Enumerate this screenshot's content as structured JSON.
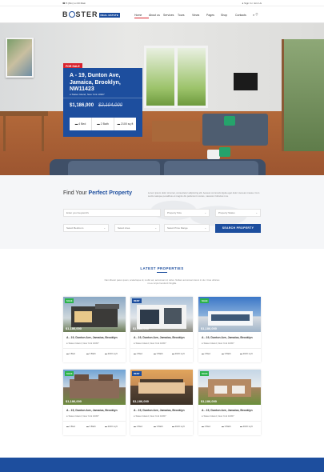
{
  "topbar": {
    "phone": "☎ 8 (8xx) xx 00 Main",
    "login": "● Sign In / Join Us"
  },
  "header": {
    "logo": {
      "b": "B",
      "rest": "STER",
      "tag": "REAL ESTATE"
    },
    "nav": [
      "Home",
      "About us",
      "Services",
      "Tours",
      "Views",
      "Pages",
      "Shop",
      "Contacts"
    ],
    "icons": "⌕  ♡"
  },
  "hero": {
    "tag": "FOR SALE",
    "address": "A - 19, Dunton Ave, Jamaica, Brooklyn, NW11423",
    "location": "● Staten Island, New York 10307",
    "price": "$1,186,000",
    "old_price": "$2,104,000",
    "features": [
      "▬ 4 Bed",
      "▬ 2 Bath",
      "▬ 2100 sq ft"
    ]
  },
  "search": {
    "title_plain": "Find Your ",
    "title_strong": "Perfect Property",
    "description": "Lorem ipsum dolor sit amet, consectetur adipiscing elit. Aenean commodo ligula eget dolor. Aenean massa. Cum sociis natoque penatibus et magnis dis parturient montes, nascetur ridiculus mus.",
    "fields": [
      "Enter your keyword's",
      "Property Size",
      "Property Status",
      "Select Bedroom",
      "Select Area",
      "Select Price Range"
    ],
    "button": "SEARCH PROPERTY"
  },
  "latest": {
    "title": "LATEST PROPERTIES",
    "description": "Nam liberar pacer quam, scelerisque id, mollis vel, accumsan id, tellus. Nullam accumsan lorem in dui. Cras ultricies mi eu turpis hendrerit fringilla."
  },
  "properties": [
    {
      "badge": "SALE",
      "badge_color": "#2bb34b",
      "price": "$1,186,000",
      "title": "A - 19, Dunton Ave, Jamaica, Brooklyn",
      "location": "● Staten Island, New York 10307",
      "feats": [
        "▬ 4 Bed",
        "▬ 3 Bath",
        "▬ 2100 sq ft"
      ]
    },
    {
      "badge": "RENT",
      "badge_color": "#1d4e9e",
      "price": "$1,186,000",
      "title": "A - 19, Dunton Ave, Jamaica, Brooklyn",
      "location": "● Staten Island, New York 10307",
      "feats": [
        "▬ 4 Bed",
        "▬ 3 Bath",
        "▬ 2100 sq ft"
      ]
    },
    {
      "badge": "SALE",
      "badge_color": "#2bb34b",
      "price": "$1,186,000",
      "title": "A - 19, Dunton Ave, Jamaica, Brooklyn",
      "location": "● Staten Island, New York 10307",
      "feats": [
        "▬ 4 Bed",
        "▬ 3 Bath",
        "▬ 2100 sq ft"
      ]
    },
    {
      "badge": "SALE",
      "badge_color": "#2bb34b",
      "price": "$1,186,000",
      "title": "A - 19, Dunton Ave, Jamaica, Brooklyn",
      "location": "● Staten Island, New York 10307",
      "feats": [
        "▬ 4 Bed",
        "▬ 3 Bath",
        "▬ 2100 sq ft"
      ]
    },
    {
      "badge": "RENT",
      "badge_color": "#1d4e9e",
      "price": "$1,186,000",
      "title": "A - 19, Dunton Ave, Jamaica, Brooklyn",
      "location": "● Staten Island, New York 10307",
      "feats": [
        "▬ 4 Bed",
        "▬ 3 Bath",
        "▬ 2100 sq ft"
      ]
    },
    {
      "badge": "SALE",
      "badge_color": "#2bb34b",
      "price": "$1,186,000",
      "title": "A - 19, Dunton Ave, Jamaica, Brooklyn",
      "location": "● Staten Island, New York 10307",
      "feats": [
        "▬ 4 Bed",
        "▬ 3 Bath",
        "▬ 2100 sq ft"
      ]
    }
  ],
  "colors": {
    "brand": "#1d4e9e",
    "accent_red": "#d9232d",
    "sale_green": "#2bb34b"
  }
}
